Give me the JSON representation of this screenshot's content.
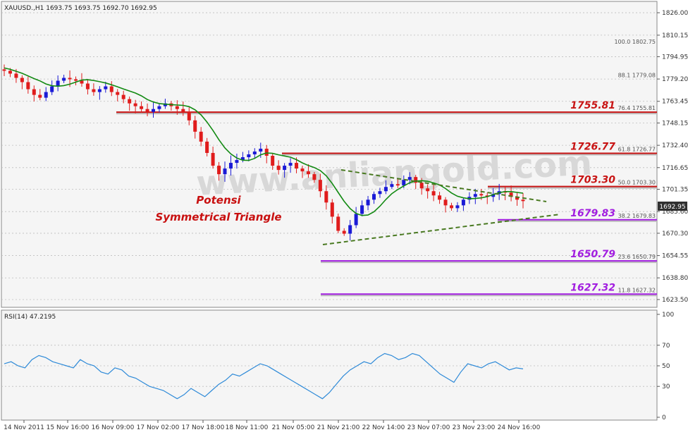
{
  "colors": {
    "background": "#ffffff",
    "plot_bg": "#f5f5f5",
    "bull": "#1a1ad6",
    "bear": "#e01c1c",
    "ma": "#128a12",
    "rsi": "#2e8ad8",
    "trendline": "#4a7a22",
    "resistance": "#c81414",
    "support": "#a21ee0",
    "watermark": "#d8d8d8",
    "annotation": "#c81010"
  },
  "header": {
    "symbol_line": "XAUUSD.,H1  1693.75 1693.75 1692.70 1692.95"
  },
  "watermark": "www.anliangold.com",
  "annotation": {
    "line1": "Potensi",
    "line2": "Symmetrical Triangle"
  },
  "price_axis": {
    "labels": [
      "1826.00",
      "1810.15",
      "1794.95",
      "1779.20",
      "1763.45",
      "1748.15",
      "1732.40",
      "1716.65",
      "1701.35",
      "1685.60",
      "1670.30",
      "1654.55",
      "1638.80",
      "1623.50"
    ],
    "current_price": "1692.95"
  },
  "rsi_panel": {
    "label": "RSI(14) 47.2195",
    "levels": [
      "100",
      "70",
      "50",
      "30",
      "0"
    ]
  },
  "time_axis": {
    "labels": [
      "14 Nov 2011",
      "15 Nov 16:00",
      "16 Nov 09:00",
      "17 Nov 02:00",
      "17 Nov 18:00",
      "18 Nov 11:00",
      "21 Nov 05:00",
      "21 Nov 21:00",
      "22 Nov 14:00",
      "23 Nov 07:00",
      "23 Nov 23:00",
      "24 Nov 16:00"
    ]
  },
  "levels": [
    {
      "kind": "resistance",
      "value_label": "1755.81",
      "fib_label": "76.4 1755.81"
    },
    {
      "kind": "resistance",
      "value_label": "1726.77",
      "fib_label": "61.8 1726.77"
    },
    {
      "kind": "resistance",
      "value_label": "1703.30",
      "fib_label": "50.0 1703.30"
    },
    {
      "kind": "support",
      "value_label": "1679.83",
      "fib_label": "38.2  1679.83"
    },
    {
      "kind": "support",
      "value_label": "1650.79",
      "fib_label": "23.6  1650.79"
    },
    {
      "kind": "support",
      "value_label": "1627.32",
      "fib_label": "11.8 1627.32"
    }
  ],
  "fib_extra": [
    "100.0 1802.75",
    "88.1 1779.08"
  ],
  "chart_data": {
    "type": "candlestick",
    "timeframe": "H1",
    "symbol": "XAUUSD.",
    "ylim": [
      1620,
      1832
    ],
    "rsi_ylim": [
      0,
      100
    ],
    "x_ticks": [
      "14 Nov 2011",
      "15 Nov 16:00",
      "16 Nov 09:00",
      "17 Nov 02:00",
      "17 Nov 18:00",
      "18 Nov 11:00",
      "21 Nov 05:00",
      "21 Nov 21:00",
      "22 Nov 14:00",
      "23 Nov 07:00",
      "23 Nov 23:00",
      "24 Nov 16:00"
    ],
    "close_path": [
      1785,
      1783,
      1780,
      1777,
      1772,
      1768,
      1766,
      1770,
      1774,
      1778,
      1780,
      1779,
      1778,
      1776,
      1772,
      1770,
      1772,
      1774,
      1770,
      1768,
      1765,
      1762,
      1760,
      1758,
      1756,
      1758,
      1760,
      1762,
      1760,
      1758,
      1756,
      1750,
      1742,
      1735,
      1727,
      1718,
      1712,
      1716,
      1720,
      1722,
      1724,
      1726,
      1728,
      1730,
      1725,
      1718,
      1715,
      1718,
      1720,
      1716,
      1714,
      1712,
      1708,
      1700,
      1692,
      1682,
      1672,
      1670,
      1676,
      1684,
      1690,
      1694,
      1698,
      1700,
      1703,
      1705,
      1704,
      1708,
      1710,
      1706,
      1702,
      1700,
      1697,
      1694,
      1690,
      1688,
      1690,
      1694,
      1696,
      1698,
      1697,
      1696,
      1698,
      1700,
      1699,
      1696,
      1694,
      1693
    ],
    "rsi_path": [
      52,
      54,
      50,
      48,
      56,
      60,
      58,
      54,
      52,
      50,
      48,
      56,
      52,
      50,
      44,
      42,
      48,
      46,
      40,
      38,
      34,
      30,
      28,
      26,
      22,
      18,
      22,
      28,
      24,
      20,
      26,
      32,
      36,
      42,
      40,
      44,
      48,
      52,
      50,
      46,
      42,
      38,
      34,
      30,
      26,
      22,
      18,
      24,
      32,
      40,
      46,
      50,
      54,
      52,
      58,
      62,
      60,
      56,
      58,
      62,
      60,
      54,
      48,
      42,
      38,
      34,
      44,
      52,
      50,
      48,
      52,
      54,
      50,
      46,
      48,
      47
    ],
    "fibonacci": [
      {
        "ratio": "100.0",
        "price": 1802.75
      },
      {
        "ratio": "88.1",
        "price": 1779.08
      },
      {
        "ratio": "76.4",
        "price": 1755.81
      },
      {
        "ratio": "61.8",
        "price": 1726.77
      },
      {
        "ratio": "50.0",
        "price": 1703.3
      },
      {
        "ratio": "38.2",
        "price": 1679.83
      },
      {
        "ratio": "23.6",
        "price": 1650.79
      },
      {
        "ratio": "11.8",
        "price": 1627.32
      }
    ],
    "rsi_last": 47.2195
  }
}
